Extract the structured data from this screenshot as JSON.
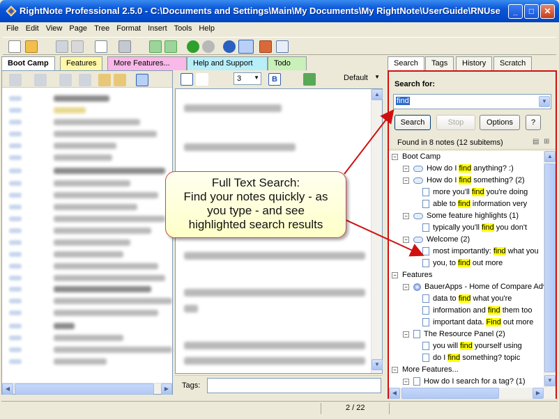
{
  "window": {
    "title": "RightNote Professional 2.5.0 - C:\\Documents and Settings\\Main\\My Documents\\My RightNote\\UserGuide\\RNUse..."
  },
  "menu": [
    "File",
    "Edit",
    "View",
    "Page",
    "Tree",
    "Format",
    "Insert",
    "Tools",
    "Help"
  ],
  "left_tabs": [
    "Boot Camp",
    "Features",
    "More Features...",
    "Help and Support",
    "Todo"
  ],
  "right_tabs": [
    "Search",
    "Tags",
    "History",
    "Scratch"
  ],
  "editor_toolbar": {
    "size_value": "3",
    "style_value": "Default"
  },
  "tags_label": "Tags:",
  "search": {
    "label": "Search for:",
    "value": "find",
    "search_btn": "Search",
    "stop_btn": "Stop",
    "options_btn": "Options",
    "found_text": "Found in 8 notes (12 subitems)"
  },
  "results": [
    {
      "level": 0,
      "type": "group",
      "text": "Boot Camp"
    },
    {
      "level": 1,
      "type": "cloud",
      "pre": "How do I ",
      "hl": "find",
      "post": " anything? :)"
    },
    {
      "level": 1,
      "type": "cloud",
      "pre": "How do I ",
      "hl": "find",
      "post": " something? (2)"
    },
    {
      "level": 2,
      "type": "page",
      "pre": "more you'll ",
      "hl": "find",
      "post": " you're doing"
    },
    {
      "level": 2,
      "type": "page",
      "pre": "able to ",
      "hl": "find",
      "post": " information very"
    },
    {
      "level": 1,
      "type": "cloud",
      "pre": "Some feature highlights (1)",
      "hl": "",
      "post": ""
    },
    {
      "level": 2,
      "type": "page",
      "pre": "typically you'll ",
      "hl": "find",
      "post": " you don't"
    },
    {
      "level": 1,
      "type": "cloud",
      "pre": "Welcome (2)",
      "hl": "",
      "post": ""
    },
    {
      "level": 2,
      "type": "page",
      "pre": "most importantly: ",
      "hl": "find",
      "post": " what you"
    },
    {
      "level": 2,
      "type": "page",
      "pre": "you, to ",
      "hl": "find",
      "post": " out more"
    },
    {
      "level": 0,
      "type": "group",
      "text": "Features"
    },
    {
      "level": 1,
      "type": "globe",
      "pre": "BauerApps - Home of Compare Adv",
      "hl": "",
      "post": ""
    },
    {
      "level": 2,
      "type": "page",
      "pre": "data to ",
      "hl": "find",
      "post": " what you're"
    },
    {
      "level": 2,
      "type": "page",
      "pre": "information and ",
      "hl": "find",
      "post": " them too"
    },
    {
      "level": 2,
      "type": "page",
      "pre": "important data. ",
      "hl": "Find",
      "post": " out more"
    },
    {
      "level": 1,
      "type": "doc",
      "pre": "The Resource Panel (2)",
      "hl": "",
      "post": ""
    },
    {
      "level": 2,
      "type": "page",
      "pre": "you will ",
      "hl": "find",
      "post": " yourself using"
    },
    {
      "level": 2,
      "type": "page",
      "pre": "do I ",
      "hl": "find",
      "post": " something? topic"
    },
    {
      "level": 0,
      "type": "group",
      "text": "More Features..."
    },
    {
      "level": 1,
      "type": "doc",
      "pre": "How do I search for a tag? (1)",
      "hl": "",
      "post": ""
    }
  ],
  "callout": {
    "line1": "Full Text Search:",
    "line2": "Find your notes quickly - as",
    "line3": "you type - and see",
    "line4": "highlighted search results"
  },
  "status": {
    "page": "2 / 22"
  },
  "colors": {
    "accent_red": "#d01010",
    "highlight": "#ffff00",
    "title_blue": "#0a56d8"
  }
}
